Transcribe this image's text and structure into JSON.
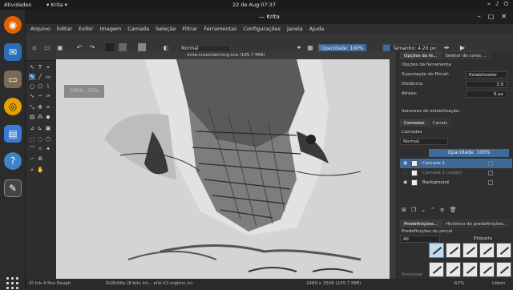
{
  "topbar": {
    "activities": "Atividades",
    "app": "▾ Krita ▾",
    "clock": "22 de Aug  07:37"
  },
  "window": {
    "title": "— Krita"
  },
  "menu": [
    "Arquivo",
    "Editar",
    "Exibir",
    "Imagem",
    "Camada",
    "Seleção",
    "Filtrar",
    "Ferramentas",
    "Configurações",
    "Janela",
    "Ajuda"
  ],
  "toolbar": {
    "mode": "Normal",
    "opacity": "Opacidade: 100%",
    "size": "Tamanho: 4.20 px"
  },
  "document": {
    "tab": "krita-crosshatching.kra (105.7 MiB)",
    "zoom_tip": "100% : 25%"
  },
  "tool_options": {
    "tabs": [
      "Opções da fe...",
      "Seletor de cores ..."
    ],
    "title": "Opções da ferramenta",
    "smoothing_label": "Suavização do Pincel:",
    "smoothing_value": "Estabilizador",
    "distance_label": "Distância:",
    "distance_value": "3.0",
    "delay_label": "Atraso:",
    "delay_value": "6 px",
    "stab_label": "Sensores de estabilização:"
  },
  "layers": {
    "tabs": [
      "Camadas",
      "Canais"
    ],
    "title": "Camadas",
    "blend": "Normal",
    "opacity": "Opacidade: 100%",
    "items": [
      {
        "name": "Camada 1",
        "selected": true
      },
      {
        "name": "Camada 2 (cópia)",
        "selected": false
      },
      {
        "name": "Background",
        "selected": false
      }
    ]
  },
  "brushes": {
    "tabs": [
      "Predefinições...",
      "Histórico de predefinições..."
    ],
    "title": "Predefinições do pincel",
    "filter": "All",
    "tag_label": "Etiqueta",
    "search_placeholder": "Pesquisar"
  },
  "status": {
    "brush": "ID  Ink-4 Pen Rough",
    "color": "RGB/Alfa (8-bits int... ellé-V2-srgbtrc.icc",
    "dims": "2480 x 3508 (105.7 MiB)",
    "zoom": "62%",
    "udemy": "Udem"
  }
}
